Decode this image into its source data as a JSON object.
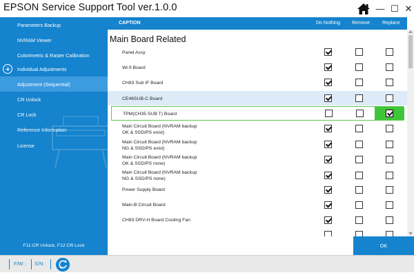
{
  "window": {
    "title": "EPSON Service Support Tool  ver.1.0.0",
    "home_icon": "home-icon",
    "minimize_glyph": "—",
    "maximize_glyph": "☐",
    "close_glyph": "✕"
  },
  "sidebar": {
    "items": [
      {
        "label": "Parameters Backup"
      },
      {
        "label": "NVRAM Viewer"
      },
      {
        "label": "Colorimetric & Raster Calibration"
      },
      {
        "label": "Individual Adjustments"
      },
      {
        "label": "Adjustment (Sequential)"
      },
      {
        "label": "CR Unlock"
      },
      {
        "label": "CR Lock"
      },
      {
        "label": "Reference Information"
      },
      {
        "label": "License"
      }
    ],
    "hint": "F11:CR Unlock, F12:CR Lock"
  },
  "table": {
    "headers": {
      "caption": "CAPTION",
      "do_nothing": "Do Nothing",
      "remove": "Remove",
      "replace": "Replace"
    },
    "section_title": "Main Board Related",
    "rows": [
      {
        "line1": "Panel Assy",
        "line2": "",
        "choice": "nothing"
      },
      {
        "line1": "Wi-fi Board",
        "line2": "",
        "choice": "nothing"
      },
      {
        "line1": "CH83 Sub IF Board",
        "line2": "",
        "choice": "nothing"
      },
      {
        "line1": "CE46SUB-C Board",
        "line2": "",
        "choice": "nothing"
      },
      {
        "line1": "TPM(CH35 SUB T) Board",
        "line2": "",
        "choice": "replace"
      },
      {
        "line1": "Main Circuit Board (NVRAM backup",
        "line2": "OK & SSD/PS exist)",
        "choice": "nothing"
      },
      {
        "line1": "Main Circuit Board (NVRAM backup",
        "line2": "NG & SSD/PS exist)",
        "choice": "nothing"
      },
      {
        "line1": "Main Circuit Board (NVRAM backup",
        "line2": "OK & SSD/PS none)",
        "choice": "nothing"
      },
      {
        "line1": "Main Circuit Board (NVRAM backup",
        "line2": "NG & SSD/PS none)",
        "choice": "nothing"
      },
      {
        "line1": "Power Supply Board",
        "line2": "",
        "choice": "nothing"
      },
      {
        "line1": "Main-B Circuit Board",
        "line2": "",
        "choice": "nothing"
      },
      {
        "line1": "CH83 DRV-H Board Cooling Fan",
        "line2": "",
        "choice": "nothing"
      }
    ]
  },
  "ok_button": {
    "label": "OK"
  },
  "statusbar": {
    "fw_label": "F/W :",
    "sn_label": "S/N :",
    "refresh_icon": "refresh-icon"
  },
  "colors": {
    "accent": "#1583cd",
    "selection_green": "#3fc53a",
    "highlight_row": "#dcebf7"
  }
}
